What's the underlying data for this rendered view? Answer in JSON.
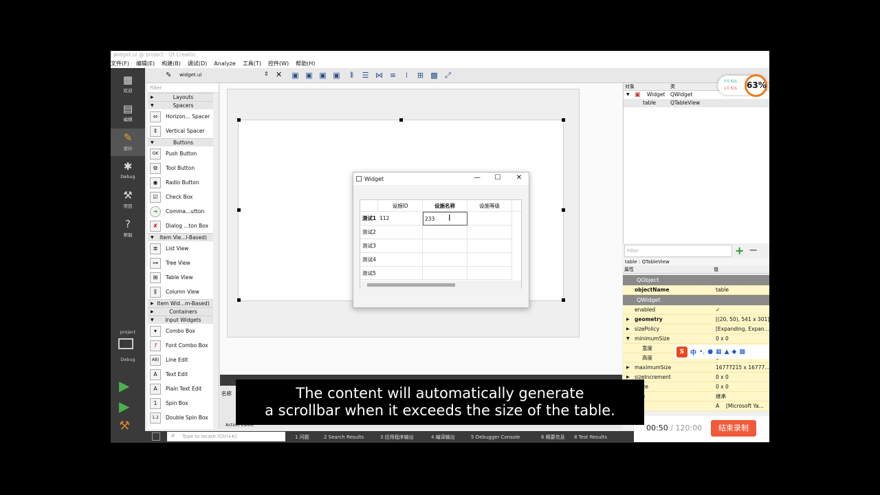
{
  "window": {
    "title": "widget.ui @ project - Qt Creator"
  },
  "menu": [
    "文件(F)",
    "编辑(E)",
    "构建(B)",
    "调试(D)",
    "Analyze",
    "工具(T)",
    "控件(W)",
    "帮助(H)"
  ],
  "modes": [
    {
      "label": "欢迎",
      "icon": "grid-icon"
    },
    {
      "label": "编辑",
      "icon": "document-icon"
    },
    {
      "label": "设计",
      "icon": "pencil-icon"
    },
    {
      "label": "Debug",
      "icon": "bug-icon"
    },
    {
      "label": "项目",
      "icon": "wrench-icon"
    },
    {
      "label": "帮助",
      "icon": "help-icon"
    }
  ],
  "kit": {
    "project": "project",
    "build": "Debug"
  },
  "editor": {
    "file": "widget.ui"
  },
  "widgetbox": {
    "filter_placeholder": "Filter",
    "cat_layouts": "Layouts",
    "cat_spacers": "Spacers",
    "spacers": [
      "Horizon... Spacer",
      "Vertical Spacer"
    ],
    "cat_buttons": "Buttons",
    "buttons": [
      "Push Button",
      "Tool Button",
      "Radio Button",
      "Check Box",
      "Comma...utton",
      "Dialog ...ton Box"
    ],
    "cat_itemviews": "Item Vie...l-Based)",
    "itemviews": [
      "List View",
      "Tree View",
      "Table View",
      "Column View"
    ],
    "cat_itemwidgets": "Item Wid...m-Based)",
    "cat_containers": "Containers",
    "cat_inputs": "Input Widgets",
    "inputs": [
      "Combo Box",
      "Font Combo Box",
      "Line Edit",
      "Text Edit",
      "Plain Text Edit",
      "Spin Box",
      "Double Spin Box"
    ]
  },
  "dialog": {
    "title": "Widget",
    "headers": [
      "设施ID",
      "设施名称",
      "设施等级"
    ],
    "rows": [
      {
        "header": "测试1",
        "cells": [
          "112",
          "233",
          ""
        ]
      },
      {
        "header": "测试2",
        "cells": [
          "",
          "",
          ""
        ]
      },
      {
        "header": "测试3",
        "cells": [
          "",
          "",
          ""
        ]
      },
      {
        "header": "测试4",
        "cells": [
          "",
          "",
          ""
        ]
      },
      {
        "header": "测试5",
        "cells": [
          "",
          "",
          ""
        ]
      }
    ]
  },
  "objinspector": {
    "col_object": "对象",
    "col_class": "类",
    "items": [
      {
        "object": "Widget",
        "class": "QWidget"
      },
      {
        "object": "table",
        "class": "QTableView"
      }
    ]
  },
  "property": {
    "filter_placeholder": "Filter",
    "object_line": "table : QTableView",
    "col_property": "属性",
    "col_value": "值",
    "sections": [
      "QObject",
      "QWidget"
    ],
    "rows": [
      {
        "name": "objectName",
        "value": "table",
        "bold": true
      },
      {
        "name": "enabled",
        "value": "✓"
      },
      {
        "name": "geometry",
        "value": "[(20, 50), 541 x 301]",
        "bold": true
      },
      {
        "name": "sizePolicy",
        "value": "[Expanding, Expan..."
      },
      {
        "name": "minimumSize",
        "value": "0 x 0"
      },
      {
        "name": "宽度",
        "value": ""
      },
      {
        "name": "高度",
        "value": "0"
      },
      {
        "name": "maximumSize",
        "value": "16777215 x 16777..."
      },
      {
        "name": "sizeIncrement",
        "value": "0 x 0"
      },
      {
        "name": "eSize",
        "value": "0 x 0"
      },
      {
        "name": "ette",
        "value": "继承"
      },
      {
        "name": "",
        "value": "[Microsoft Ya..."
      }
    ]
  },
  "statusbar": {
    "locate_placeholder": "Type to locate (Ctrl+K)",
    "tabs": [
      "1  问题",
      "2  Search Results",
      "3  应用程序输出",
      "4  编译输出",
      "5  Debugger Console",
      "6  概要信息",
      "8  Test Results"
    ]
  },
  "output_dock": {
    "col_name": "名称",
    "tab": "Action Editor"
  },
  "net": {
    "up": "↑0  K/s",
    "down": "↓0  K/s",
    "percent": "63%"
  },
  "recording": {
    "time": "00:50",
    "total": "120:00",
    "stop_label": "结束录制"
  },
  "caption": {
    "line1": "The content will automatically generate",
    "line2": "a scrollbar when it exceeds the size of the table."
  }
}
